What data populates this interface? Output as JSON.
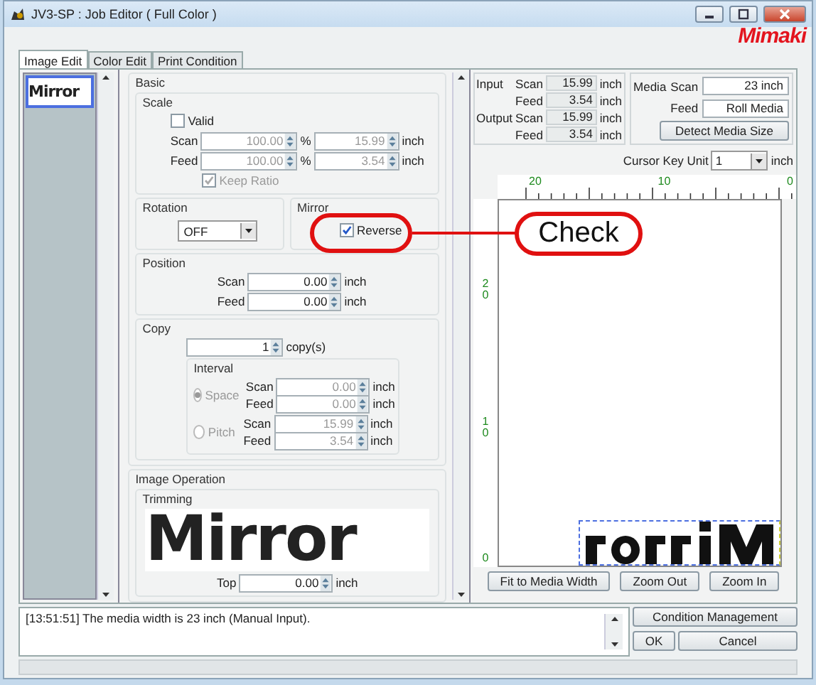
{
  "window": {
    "title": "JV3-SP : Job Editor ( Full Color )",
    "logo": "Mimaki"
  },
  "tabs": [
    {
      "label": "Image Edit",
      "selected": true
    },
    {
      "label": "Color Edit",
      "selected": false
    },
    {
      "label": "Print Condition",
      "selected": false
    }
  ],
  "thumbnails": [
    {
      "preview_text": "Mirror",
      "selected": true
    }
  ],
  "basic": {
    "title": "Basic",
    "scale": {
      "title": "Scale",
      "disabled": true,
      "valid": {
        "label": "Valid",
        "checked": false
      },
      "rows": [
        {
          "label": "Scan",
          "percent": "100.00",
          "percent_unit": "%",
          "size": "15.99",
          "unit": "inch"
        },
        {
          "label": "Feed",
          "percent": "100.00",
          "percent_unit": "%",
          "size": "3.54",
          "unit": "inch"
        }
      ],
      "keep_ratio": {
        "label": "Keep Ratio",
        "checked": true
      }
    },
    "rotation": {
      "title": "Rotation",
      "value": "OFF"
    },
    "mirror": {
      "title": "Mirror",
      "reverse": {
        "label": "Reverse",
        "checked": true
      }
    },
    "position": {
      "title": "Position",
      "rows": [
        {
          "label": "Scan",
          "value": "0.00",
          "unit": "inch"
        },
        {
          "label": "Feed",
          "value": "0.00",
          "unit": "inch"
        }
      ]
    },
    "copy": {
      "title": "Copy",
      "count": "1",
      "unit": "copy(s)",
      "interval": {
        "title": "Interval",
        "disabled": true,
        "options": [
          {
            "label": "Space",
            "selected": true,
            "rows": [
              {
                "label": "Scan",
                "value": "0.00",
                "unit": "inch"
              },
              {
                "label": "Feed",
                "value": "0.00",
                "unit": "inch"
              }
            ]
          },
          {
            "label": "Pitch",
            "selected": false,
            "rows": [
              {
                "label": "Scan",
                "value": "15.99",
                "unit": "inch"
              },
              {
                "label": "Feed",
                "value": "3.54",
                "unit": "inch"
              }
            ]
          }
        ]
      }
    }
  },
  "image_operation": {
    "title": "Image Operation",
    "trimming": {
      "title": "Trimming",
      "preview_text": "Mirror",
      "rows": [
        {
          "label": "Top",
          "value": "0.00",
          "unit": "inch"
        }
      ]
    }
  },
  "measurements": [
    {
      "label": "Input",
      "rows": [
        {
          "label": "Scan",
          "value": "15.99",
          "unit": "inch"
        },
        {
          "label": "Feed",
          "value": "3.54",
          "unit": "inch"
        }
      ]
    },
    {
      "label": "Output",
      "rows": [
        {
          "label": "Scan",
          "value": "15.99",
          "unit": "inch"
        },
        {
          "label": "Feed",
          "value": "3.54",
          "unit": "inch"
        }
      ]
    }
  ],
  "media": {
    "label": "Media",
    "rows": [
      {
        "label": "Scan",
        "value": "23 inch"
      },
      {
        "label": "Feed",
        "value": "Roll Media"
      }
    ],
    "button": "Detect Media Size"
  },
  "cursor_key": {
    "label": "Cursor Key Unit",
    "value": "1",
    "unit": "inch"
  },
  "preview": {
    "x_ruler": [
      "20",
      "10",
      "0"
    ],
    "y_ruler": [
      "20",
      "10",
      "0"
    ],
    "buttons": [
      "Fit to Media Width",
      "Zoom Out",
      "Zoom In"
    ]
  },
  "log": [
    "[13:51:51] The media width is 23 inch (Manual Input)."
  ],
  "buttons": {
    "condition": "Condition Management",
    "ok": "OK",
    "cancel": "Cancel"
  },
  "callout": {
    "label": "Check"
  }
}
